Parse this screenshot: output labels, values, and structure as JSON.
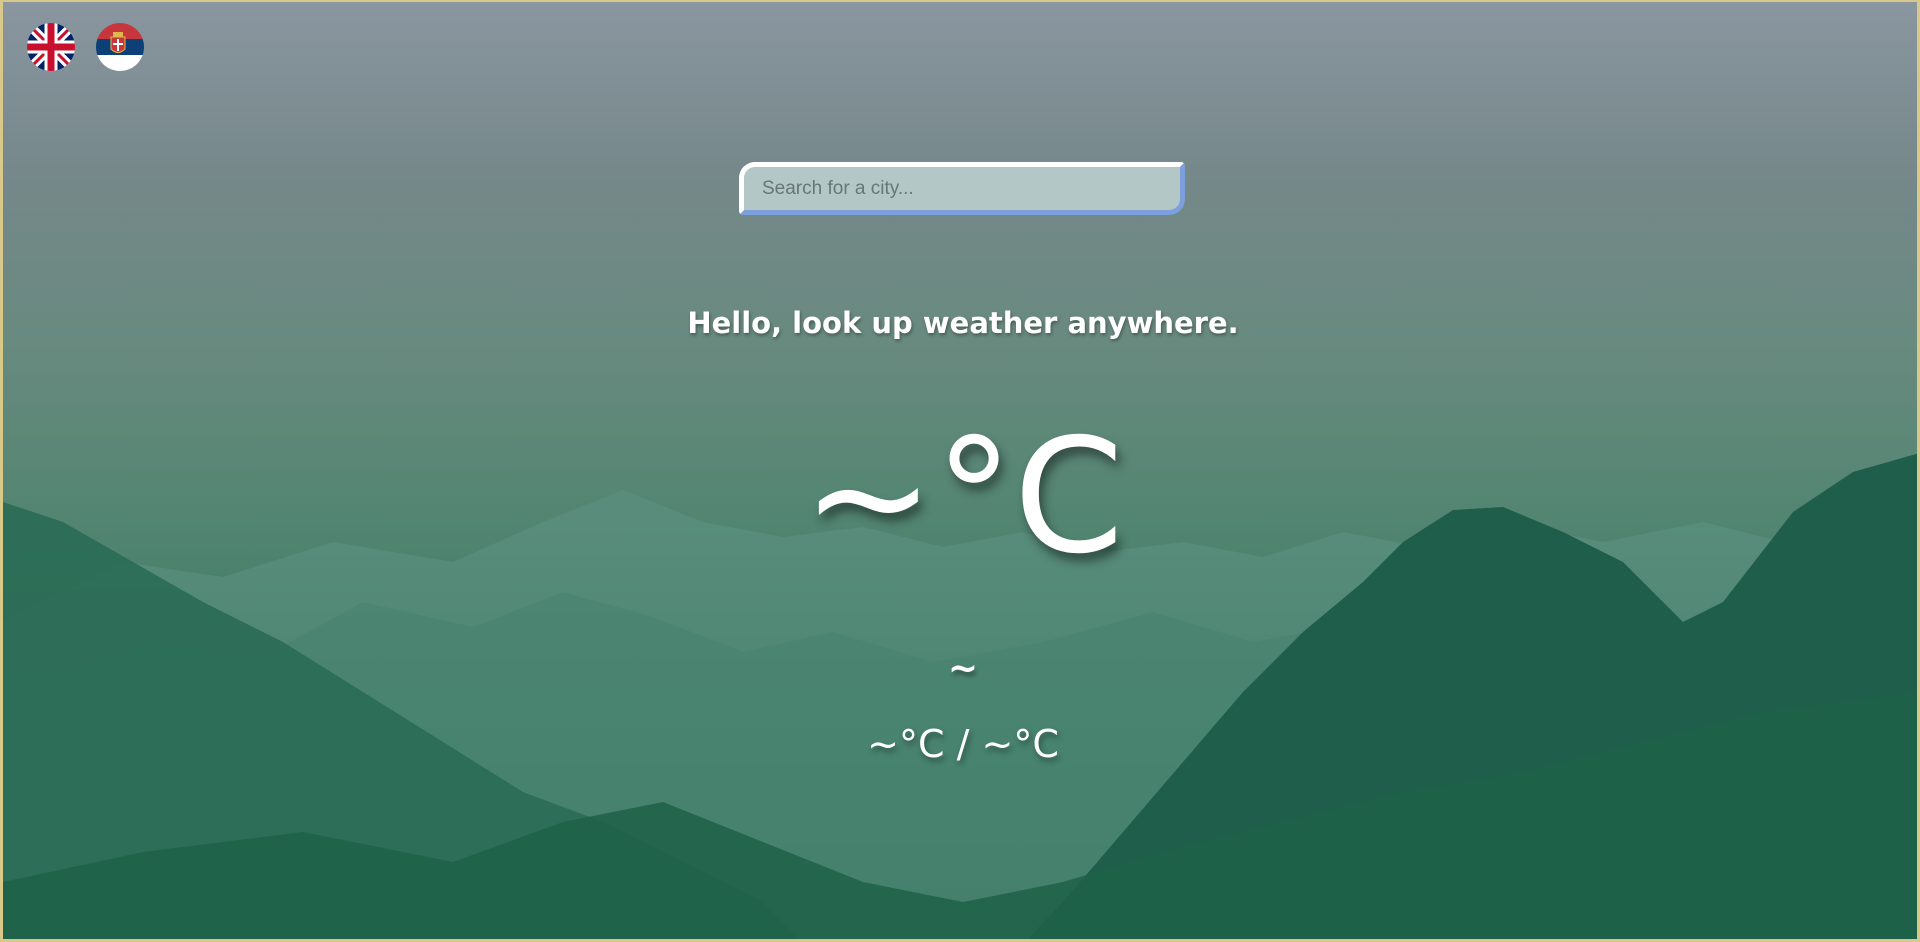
{
  "languages": [
    {
      "code": "en",
      "icon": "uk-flag-icon"
    },
    {
      "code": "sr",
      "icon": "serbia-flag-icon"
    }
  ],
  "search": {
    "placeholder": "Search for a city...",
    "value": ""
  },
  "greeting": "Hello, look up weather anywhere.",
  "weather": {
    "temperature": "~°C",
    "condition": "~",
    "hi_lo": "~°C / ~°C"
  },
  "colors": {
    "sky_top": "#8a96a0",
    "forest_bottom": "#1c5f46",
    "search_bg": "#b3c8c6",
    "search_accent": "#7da0dd",
    "frame": "#d8c98a"
  }
}
